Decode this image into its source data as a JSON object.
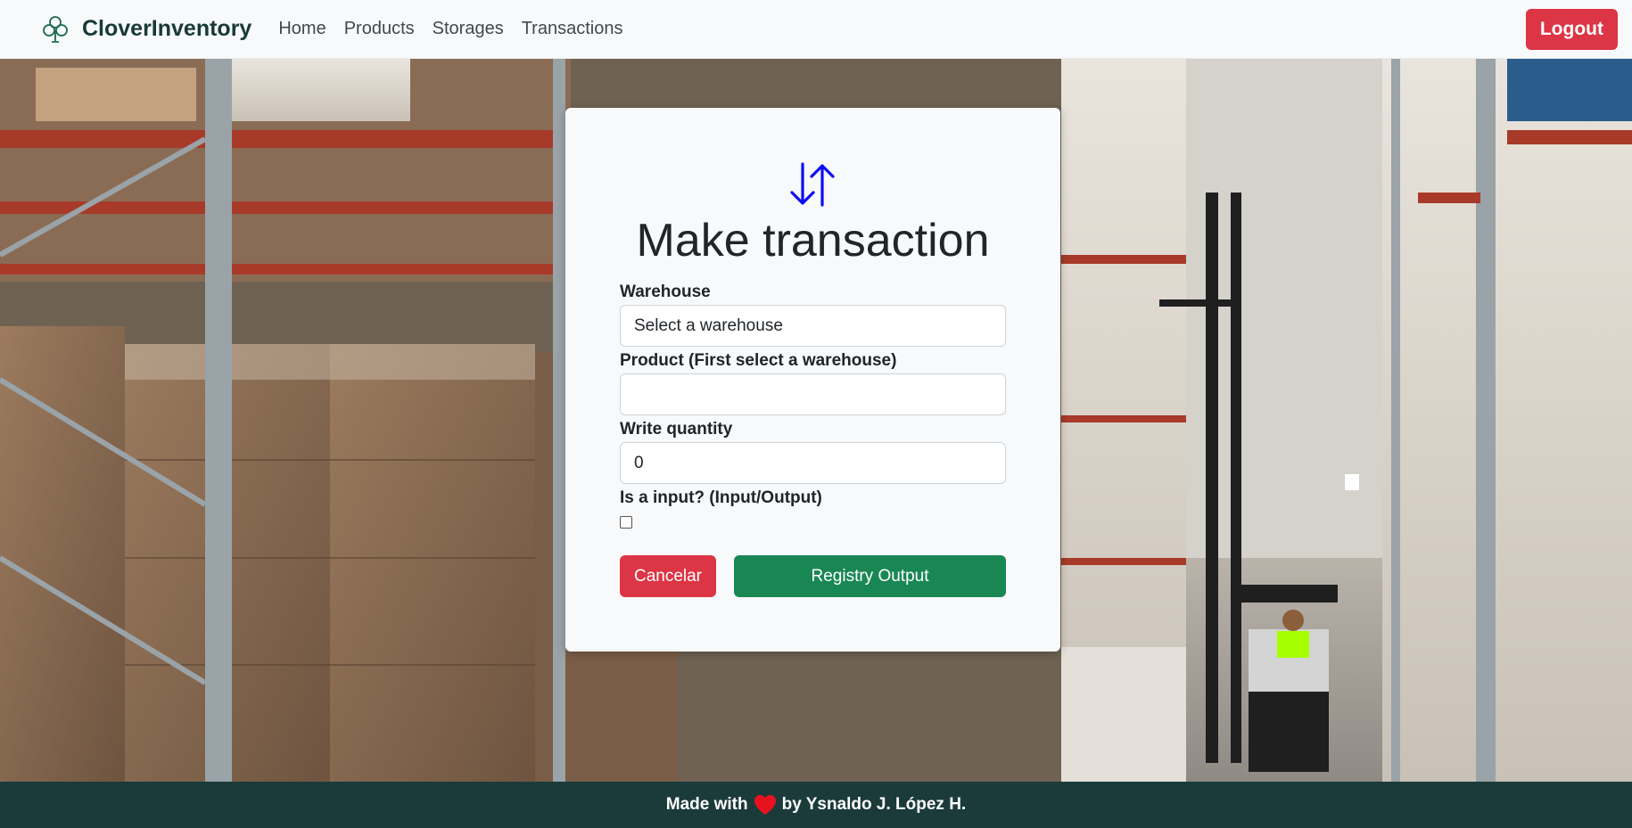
{
  "navbar": {
    "brand": "CloverInventory",
    "brand_icon": "clover-icon",
    "links": [
      "Home",
      "Products",
      "Storages",
      "Transactions"
    ],
    "logout_label": "Logout"
  },
  "form": {
    "icon": "arrow-down-up-icon",
    "title": "Make transaction",
    "warehouse_label": "Warehouse",
    "warehouse_value": "Select a warehouse",
    "product_label": "Product (First select a warehouse)",
    "product_value": "",
    "quantity_label": "Write quantity",
    "quantity_value": "0",
    "input_label": "Is a input? (Input/Output)",
    "is_input": false,
    "cancel_label": "Cancelar",
    "submit_label": "Registry Output"
  },
  "footer": {
    "text_before": "Made with",
    "heart_icon": "heart-icon",
    "text_after": "by Ysnaldo J. López H."
  },
  "colors": {
    "danger": "#dc3545",
    "success": "#198754",
    "footer_bg": "#1b3b3a",
    "icon_blue": "#0d0df0"
  }
}
